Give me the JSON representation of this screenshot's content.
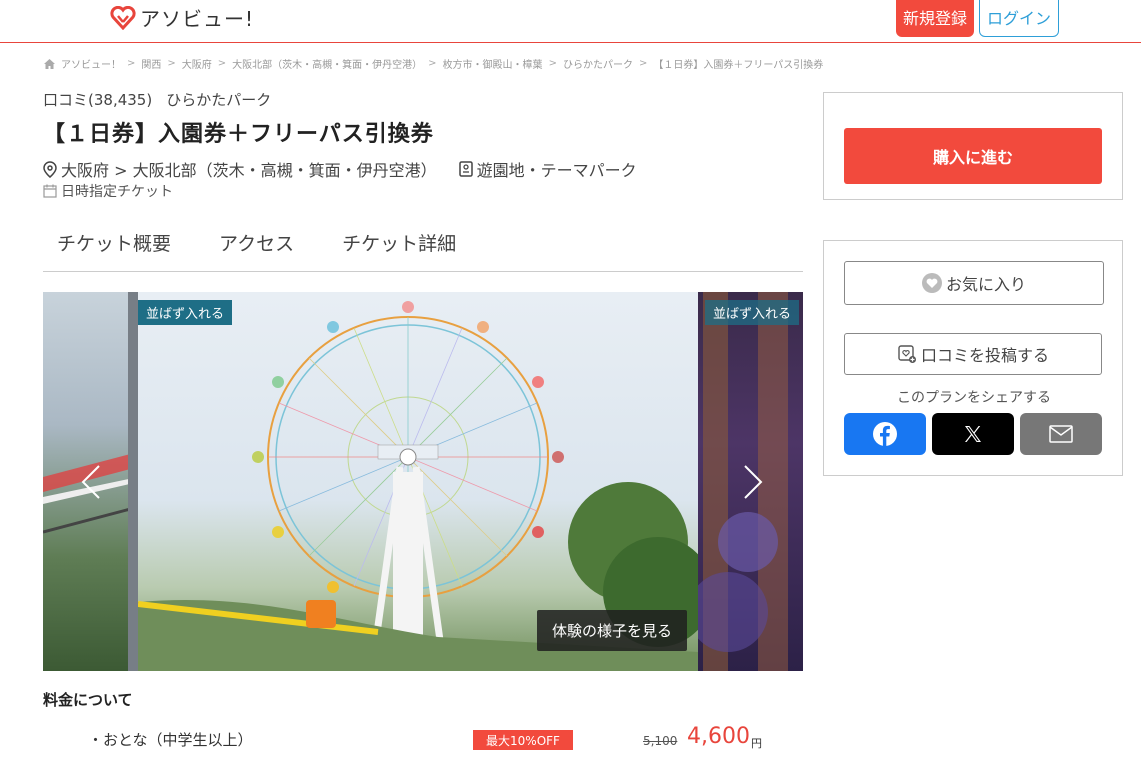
{
  "header": {
    "logo_text": "アソビュー!",
    "register_label": "新規登録",
    "login_label": "ログイン"
  },
  "breadcrumb": [
    "アソビュー！",
    "関西",
    "大阪府",
    "大阪北部（茨木・高槻・箕面・伊丹空港）",
    "枚方市・御殿山・樟葉",
    "ひらかたパーク",
    "【１日券】入園券＋フリーパス引換券"
  ],
  "plan": {
    "reviews": "口コミ(38,435)",
    "facility": "ひらかたパーク",
    "title": "【１日券】入園券＋フリーパス引換券",
    "location": "大阪府 > 大阪北部（茨木・高槻・箕面・伊丹空港）",
    "category": "遊園地・テーマパーク",
    "ticket_type": "日時指定チケット"
  },
  "tabs": [
    "チケット概要",
    "アクセス",
    "チケット詳細"
  ],
  "gallery": {
    "badge_main": "並ばず入れる",
    "badge_right": "並ばず入れる",
    "experience_button": "体験の様子を見る"
  },
  "pricing": {
    "heading": "料金について",
    "rows": [
      {
        "label": "・おとな（中学生以上）",
        "badge": "最大10%OFF",
        "old_price": "5,100",
        "new_price": "4,600",
        "unit": "円"
      }
    ]
  },
  "sidebar": {
    "buy_label": "購入に進む",
    "favorite_label": "お気に入り",
    "review_label": "口コミを投稿する",
    "share_label": "このプランをシェアする"
  },
  "colors": {
    "accent": "#f24a3d",
    "link": "#2e9fd8",
    "badge": "#1e6e86",
    "facebook": "#1877f2"
  }
}
